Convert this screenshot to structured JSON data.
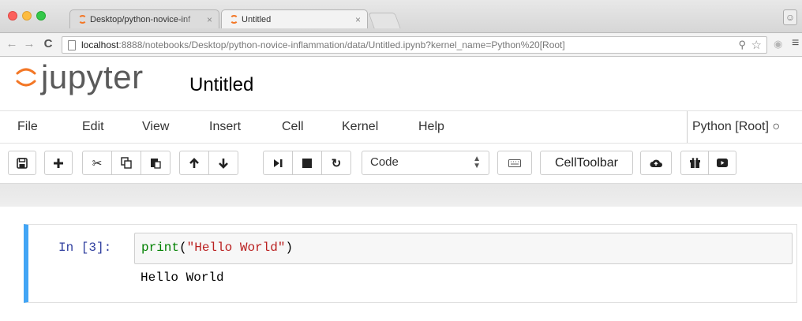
{
  "browser": {
    "tabs": [
      {
        "title": "Desktop/python-novice-inf",
        "close": "×"
      },
      {
        "title": "Untitled",
        "close": "×"
      }
    ],
    "url_host": "localhost",
    "url_rest": ":8888/notebooks/Desktop/python-novice-inflammation/data/Untitled.ipynb?kernel_name=Python%20[Root]"
  },
  "jupyter": {
    "logo_text": "jupyter",
    "notebook_title": "Untitled",
    "menu": [
      "File",
      "Edit",
      "View",
      "Insert",
      "Cell",
      "Kernel",
      "Help"
    ],
    "kernel_name": "Python [Root]",
    "cell_type_select": "Code",
    "celltoolbar_label": "CellToolbar"
  },
  "cell": {
    "prompt": "In [3]:",
    "code_builtin": "print",
    "code_open": "(",
    "code_string": "\"Hello World\"",
    "code_close": ")",
    "output": "Hello World"
  },
  "colors": {
    "accent_cell_border": "#42a5f5",
    "jupyter_orange": "#f37726",
    "prompt_blue": "#303f9f"
  }
}
